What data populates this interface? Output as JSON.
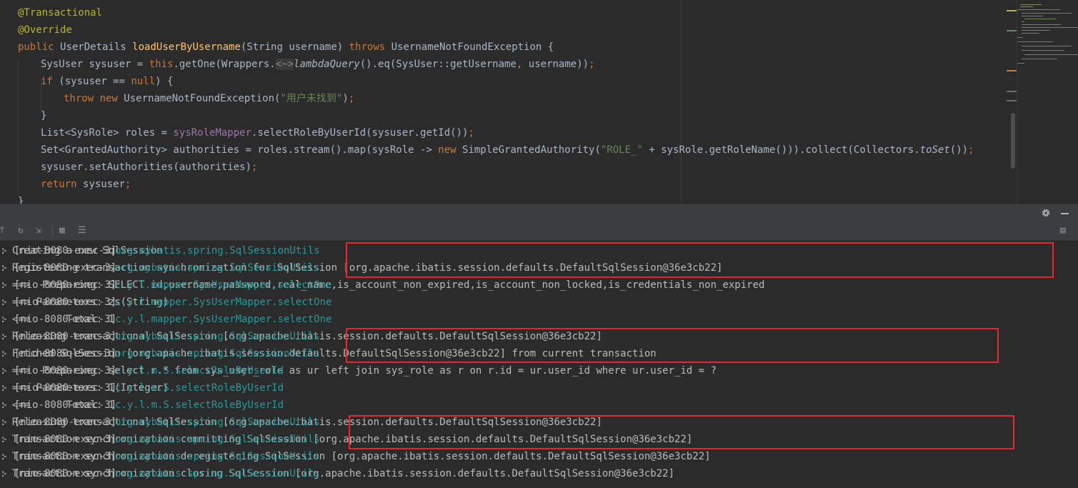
{
  "editor": {
    "lines": [
      [
        {
          "t": "@Transactional",
          "c": "t-ann"
        }
      ],
      [
        {
          "t": "@Override",
          "c": "t-ann"
        }
      ],
      [
        {
          "t": "public ",
          "c": "t-kw"
        },
        {
          "t": "UserDetails "
        },
        {
          "t": "loadUserByUsername",
          "c": "t-fn"
        },
        {
          "t": "(String username) "
        },
        {
          "t": "throws ",
          "c": "t-kw"
        },
        {
          "t": "UsernameNotFoundException {"
        }
      ],
      [
        {
          "t": "SysUser sysuser = "
        },
        {
          "t": "this",
          "c": "t-kw"
        },
        {
          "t": ".getOne(Wrappers."
        },
        {
          "t": "<~>",
          "c": "t-fold"
        },
        {
          "t": "lambdaQuery",
          "c": "t-it"
        },
        {
          "t": "().eq(SysUser::getUsername"
        },
        {
          "t": ", ",
          "c": "t-kw"
        },
        {
          "t": "username))"
        },
        {
          "t": ";",
          "c": "t-kw"
        }
      ],
      [
        {
          "t": "if ",
          "c": "t-kw"
        },
        {
          "t": "(sysuser == "
        },
        {
          "t": "null",
          "c": "t-kw"
        },
        {
          "t": ") {"
        }
      ],
      [
        {
          "t": "throw new ",
          "c": "t-kw"
        },
        {
          "t": "UsernameNotFoundException("
        },
        {
          "t": "\"用户未找到\"",
          "c": "t-str"
        },
        {
          "t": ")"
        },
        {
          "t": ";",
          "c": "t-kw"
        }
      ],
      [
        {
          "t": "}"
        }
      ],
      [
        {
          "t": "List<SysRole> roles = "
        },
        {
          "t": "sysRoleMapper",
          "c": "t-field"
        },
        {
          "t": ".selectRoleByUserId(sysuser.getId())"
        },
        {
          "t": ";",
          "c": "t-kw"
        }
      ],
      [
        {
          "t": "Set<GrantedAuthority> authorities = roles.stream().map(sysRole -> "
        },
        {
          "t": "new ",
          "c": "t-kw"
        },
        {
          "t": "SimpleGrantedAuthority("
        },
        {
          "t": "\"ROLE_\"",
          "c": "t-str"
        },
        {
          "t": " + sysRole.getRoleName())).collect(Collectors."
        },
        {
          "t": "toSet",
          "c": "t-it"
        },
        {
          "t": "())"
        },
        {
          "t": ";",
          "c": "t-kw"
        }
      ],
      [
        {
          "t": "sysuser.setAuthorities(authorities)"
        },
        {
          "t": ";",
          "c": "t-kw"
        }
      ],
      [
        {
          "t": "return ",
          "c": "t-kw"
        },
        {
          "t": "sysuser"
        },
        {
          "t": ";",
          "c": "t-kw"
        }
      ],
      [
        {
          "t": "}"
        }
      ]
    ]
  },
  "toolbar": {
    "settings_icon": "gear-icon",
    "minimize_icon": "minimize-icon"
  },
  "console": {
    "rows": [
      {
        "thread": "- [nio-8080-exec-3]",
        "logger": "org.mybatis.spring.SqlSessionUtils",
        "message": ": Creating a new SqlSession"
      },
      {
        "thread": "- [nio-8080-exec-3]",
        "logger": "org.mybatis.spring.SqlSessionUtils",
        "message": ": Registering transaction synchronization for SqlSession [org.apache.ibatis.session.defaults.DefaultSqlSession@36e3cb22]"
      },
      {
        "thread": "- [nio-8080-exec-3]",
        "logger": "c.y.l.mapper.SysUserMapper.selectOne",
        "message": ": ==>  Preparing: SELECT id,username,password,real_name,is_account_non_expired,is_account_non_locked,is_credentials_non_expired"
      },
      {
        "thread": "- [nio-8080-exec-3]",
        "logger": "c.y.l.mapper.SysUserMapper.selectOne",
        "message": ": ==> Parameters: zs(String)"
      },
      {
        "thread": "- [nio-8080-exec-3]",
        "logger": "c.y.l.mapper.SysUserMapper.selectOne",
        "message": ": <==      Total: 1"
      },
      {
        "thread": "- [nio-8080-exec-3]",
        "logger": "org.mybatis.spring.SqlSessionUtils",
        "message": ": Releasing transactional SqlSession [org.apache.ibatis.session.defaults.DefaultSqlSession@36e3cb22]"
      },
      {
        "thread": "- [nio-8080-exec-3]",
        "logger": "org.mybatis.spring.SqlSessionUtils",
        "message": ": Fetched SqlSession [org.apache.ibatis.session.defaults.DefaultSqlSession@36e3cb22] from current transaction"
      },
      {
        "thread": "- [nio-8080-exec-3]",
        "logger": "c.y.l.m.S.selectRoleByUserId",
        "message": ": ==>  Preparing: select r.* from sys_user_role as ur left join sys_role as r on r.id = ur.user_id where ur.user_id = ?"
      },
      {
        "thread": "- [nio-8080-exec-3]",
        "logger": "c.y.l.m.S.selectRoleByUserId",
        "message": ": ==> Parameters: 1(Integer)"
      },
      {
        "thread": "- [nio-8080-exec-3]",
        "logger": "c.y.l.m.S.selectRoleByUserId",
        "message": ": <==      Total: 1"
      },
      {
        "thread": "- [nio-8080-exec-3]",
        "logger": "org.mybatis.spring.SqlSessionUtils",
        "message": ": Releasing transactional SqlSession [org.apache.ibatis.session.defaults.DefaultSqlSession@36e3cb22]"
      },
      {
        "thread": "- [nio-8080-exec-3]",
        "logger": "org.mybatis.spring.SqlSessionUtils",
        "message": ": Transaction synchronization committing SqlSession [org.apache.ibatis.session.defaults.DefaultSqlSession@36e3cb22]"
      },
      {
        "thread": "- [nio-8080-exec-3]",
        "logger": "org.mybatis.spring.SqlSessionUtils",
        "message": ": Transaction synchronization deregistering SqlSession [org.apache.ibatis.session.defaults.DefaultSqlSession@36e3cb22]"
      },
      {
        "thread": "- [nio-8080-exec-3]",
        "logger": "org.mybatis.spring.SqlSessionUtils",
        "message": ": Transaction synchronization closing SqlSession [org.apache.ibatis.session.defaults.DefaultSqlSession@36e3cb22]"
      }
    ]
  },
  "colors": {
    "highlight_box": "#e8262f",
    "logger_text": "#299999",
    "keyword": "#cc7832",
    "annotation": "#bbb529",
    "string": "#6a8759"
  }
}
